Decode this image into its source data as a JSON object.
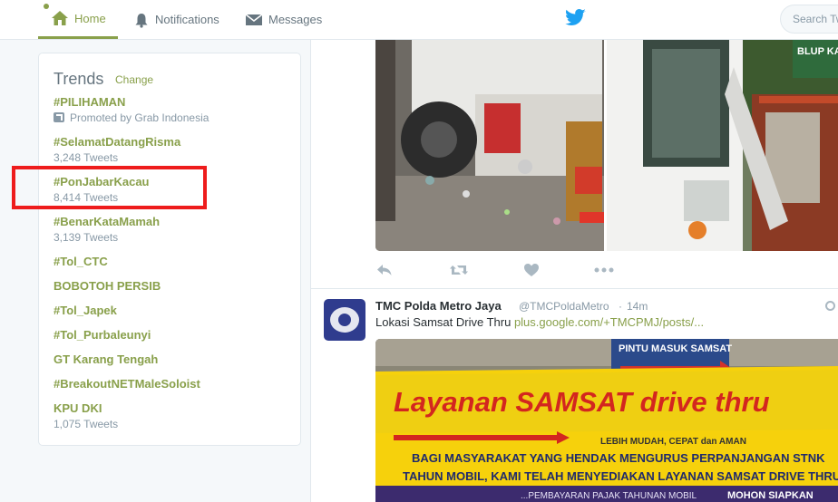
{
  "nav": {
    "home": "Home",
    "notifications": "Notifications",
    "messages": "Messages",
    "search_placeholder": "Search Tw"
  },
  "trends": {
    "title": "Trends",
    "change": "Change",
    "items": [
      {
        "tag": "#PILIHAMAN",
        "meta": "Promoted by Grab Indonesia",
        "promoted": true
      },
      {
        "tag": "#SelamatDatangRisma",
        "meta": "3,248 Tweets"
      },
      {
        "tag": "#PonJabarKacau",
        "meta": "8,414 Tweets"
      },
      {
        "tag": "#BenarKataMamah",
        "meta": "3,139 Tweets"
      },
      {
        "tag": "#Tol_CTC",
        "meta": ""
      },
      {
        "tag": "BOBOTOH PERSIB",
        "meta": ""
      },
      {
        "tag": "#Tol_Japek",
        "meta": ""
      },
      {
        "tag": "#Tol_Purbaleunyi",
        "meta": ""
      },
      {
        "tag": "GT Karang Tengah",
        "meta": ""
      },
      {
        "tag": "#BreakoutNETMaleSoloist",
        "meta": ""
      },
      {
        "tag": "KPU DKI",
        "meta": "1,075 Tweets"
      }
    ]
  },
  "tweet": {
    "name": "TMC Polda Metro Jaya",
    "handle": "@TMCPoldaMetro",
    "dot": "·",
    "time": "14m",
    "text": "Lokasi Samsat Drive Thru ",
    "link": "plus.google.com/+TMCPMJ/posts/...",
    "banner": {
      "sign": "PINTU MASUK SAMSAT",
      "headline": "Layanan SAMSAT drive thru",
      "sub": "LEBIH MUDAH, CEPAT dan AMAN",
      "line1": "BAGI MASYARAKAT YANG HENDAK MENGURUS PERPANJANGAN STNK",
      "line2": "TAHUN MOBIL, KAMI TELAH MENYEDIAKAN LAYANAN SAMSAT DRIVE THRU",
      "line3": "...PEMBAYARAN PAJAK TAHUNAN MOBIL",
      "line4": "MOHON SIAPKAN"
    },
    "photo_sign": "BLUP KARAWAN"
  },
  "colors": {
    "accent": "#89a04b",
    "highlight": "#ee1c1c",
    "twitter_blue": "#1da1f2"
  }
}
